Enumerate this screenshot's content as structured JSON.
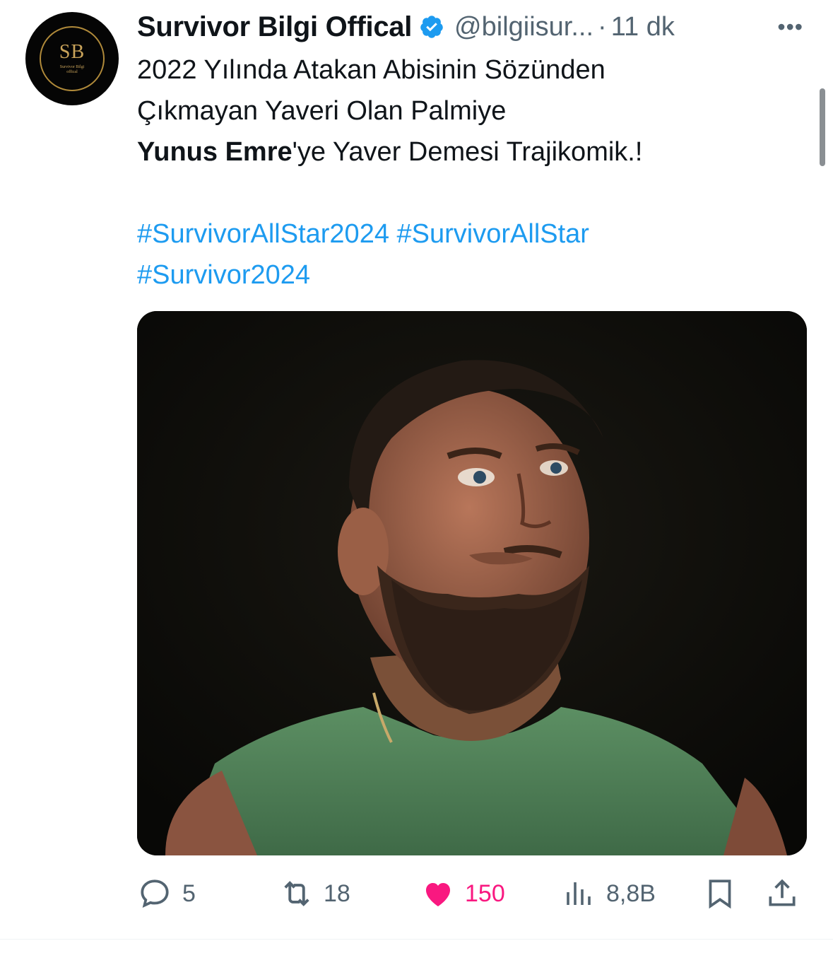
{
  "author": {
    "name": "Survivor Bilgi Offical",
    "handle": "@bilgiisur...",
    "separator": "·",
    "time": "11 dk",
    "avatar": {
      "monogram": "SB",
      "subtitle_line1": "Survivor Bilgi",
      "subtitle_line2": "offical"
    },
    "verified_icon": "verified-badge-icon"
  },
  "more_label": "•••",
  "tweet": {
    "line1": "2022 Yılında Atakan Abisinin Sözünden",
    "line2": "Çıkmayan Yaveri Olan Palmiye",
    "line3_bold": "Yunus Emre",
    "line3_rest": "'ye Yaver Demesi Trajikomik.!",
    "hashtags": [
      "#SurvivorAllStar2024",
      "#SurvivorAllStar",
      "#Survivor2024"
    ]
  },
  "actions": {
    "replies": "5",
    "retweets": "18",
    "likes": "150",
    "views": "8,8B"
  },
  "colors": {
    "hashtag": "#1d9bf0",
    "like": "#f91880",
    "muted": "#536471",
    "verified": "#1d9bf0"
  }
}
